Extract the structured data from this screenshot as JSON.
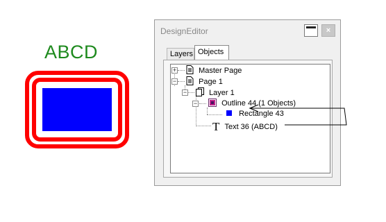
{
  "canvas": {
    "text": "ABCD",
    "colors": {
      "text": "#1e8a1e",
      "outline": "#ff0000",
      "fill": "#0000ff"
    }
  },
  "window": {
    "title": "DesignEditor",
    "close_glyph": "×",
    "tabs": [
      {
        "label": "Layers",
        "selected": false
      },
      {
        "label": "Objects",
        "selected": true
      }
    ],
    "tree": {
      "master_page": "Master Page",
      "page": "Page 1",
      "layer": "Layer 1",
      "outline": "Outline 44 (1 Objects)",
      "rectangle": "Rectangle 43",
      "text_glyph": "T",
      "text_item": "Text 36 (ABCD)"
    },
    "icons": {
      "page": "page-icon",
      "layer": "layer-icon",
      "outline": "outline-group-icon",
      "rectangle": "rectangle-icon",
      "text": "text-icon"
    }
  }
}
